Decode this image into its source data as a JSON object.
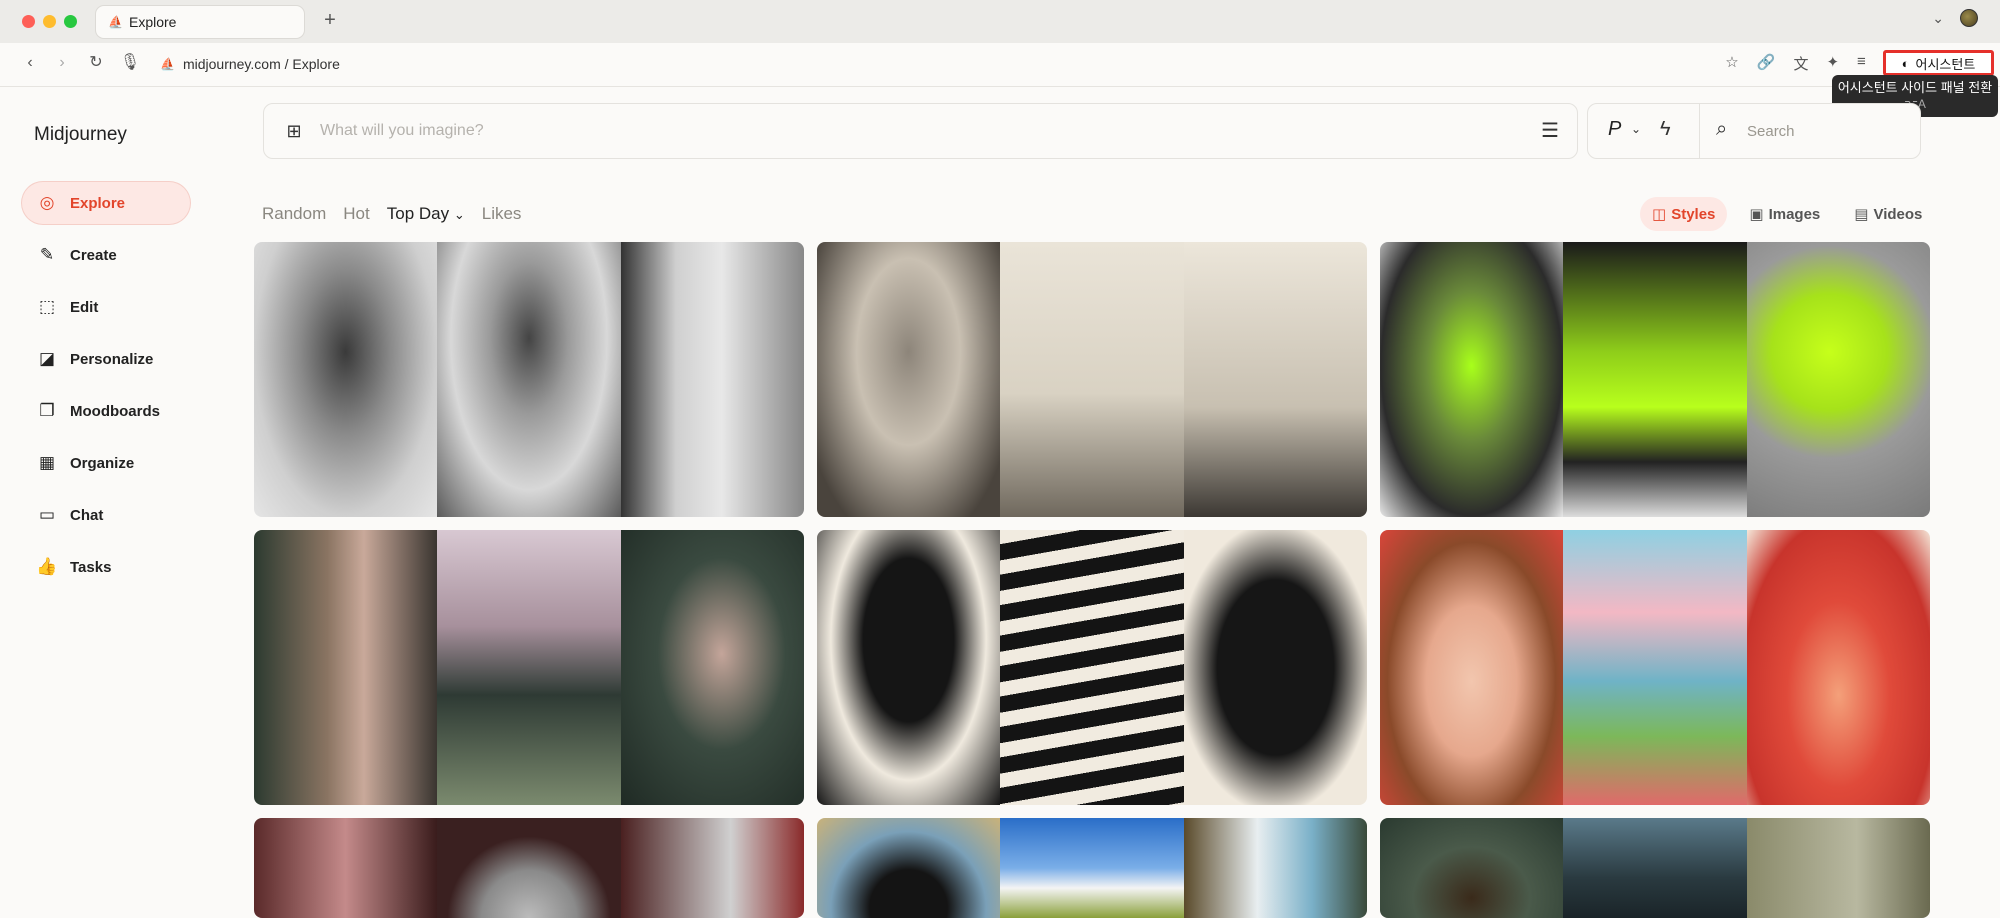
{
  "browser": {
    "tab_title": "Explore",
    "url": "midjourney.com / Explore",
    "assistant_label": "어시스턴트",
    "tooltip_text": "어시스턴트 사이드 패널 전환",
    "tooltip_shortcut": "⌥A"
  },
  "sidebar": {
    "brand": "Midjourney",
    "items": [
      {
        "label": "Explore",
        "icon": "compass-icon"
      },
      {
        "label": "Create",
        "icon": "brush-icon"
      },
      {
        "label": "Edit",
        "icon": "edit-icon"
      },
      {
        "label": "Personalize",
        "icon": "personalize-icon"
      },
      {
        "label": "Moodboards",
        "icon": "moodboard-icon"
      },
      {
        "label": "Organize",
        "icon": "grid-icon"
      },
      {
        "label": "Chat",
        "icon": "chat-icon"
      },
      {
        "label": "Tasks",
        "icon": "thumbs-up-icon"
      }
    ]
  },
  "prompt": {
    "placeholder": "What will you imagine?"
  },
  "search": {
    "mode_label": "P",
    "placeholder": "Search"
  },
  "sort_tabs": [
    "Random",
    "Hot",
    "Top Day",
    "Likes"
  ],
  "type_tabs": [
    "Styles",
    "Images",
    "Videos"
  ],
  "colors": {
    "accent": "#e2452b",
    "accent_bg": "#fde8e4"
  }
}
